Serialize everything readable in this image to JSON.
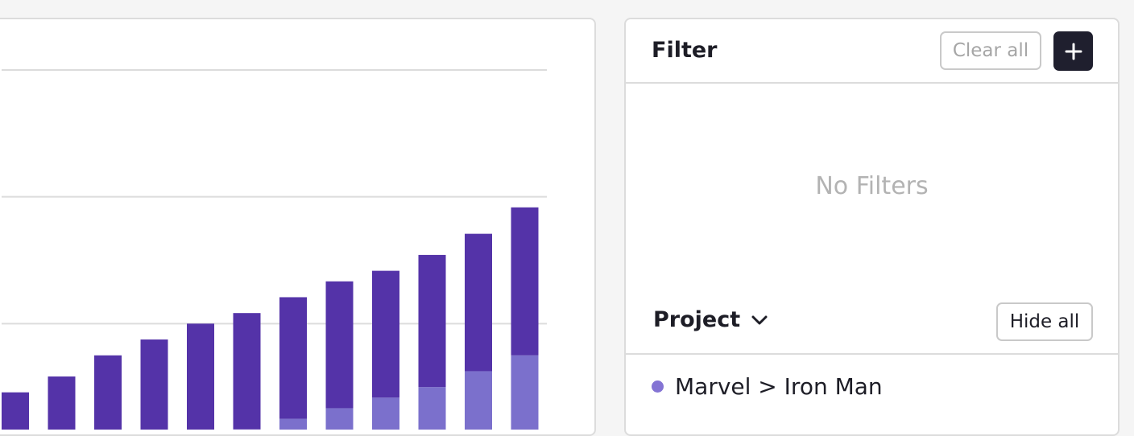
{
  "chart_data": {
    "type": "bar",
    "stacked": true,
    "grid": true,
    "legend": "none",
    "categories": [
      "",
      "",
      "",
      "",
      "",
      "",
      "",
      "",
      "",
      "",
      "",
      ""
    ],
    "ylim": [
      0,
      70
    ],
    "series": [
      {
        "values": [
          0,
          0,
          0,
          0,
          2,
          4,
          6,
          8,
          10,
          12,
          15,
          18
        ],
        "color": "#7b70cc"
      },
      {
        "values": [
          11,
          14,
          18,
          21,
          22,
          22,
          23,
          24,
          24,
          25,
          26,
          28
        ],
        "color": "#5433a8"
      }
    ],
    "gridlines": [
      24,
      48,
      72
    ]
  },
  "colors": {
    "bar_dark": "#5433a8",
    "bar_light": "#7b70cc",
    "gridline": "#dcdcdc",
    "button_dark": "#1f1f2e",
    "project_dot": "#8474d4"
  },
  "filter": {
    "title": "Filter",
    "clear_all_label": "Clear all",
    "add_icon": "plus-icon",
    "empty_text": "No Filters"
  },
  "project": {
    "label": "Project",
    "toggle_icon": "chevron-down-icon",
    "hide_all_label": "Hide all",
    "items": [
      {
        "label": "Marvel > Iron Man"
      }
    ]
  }
}
